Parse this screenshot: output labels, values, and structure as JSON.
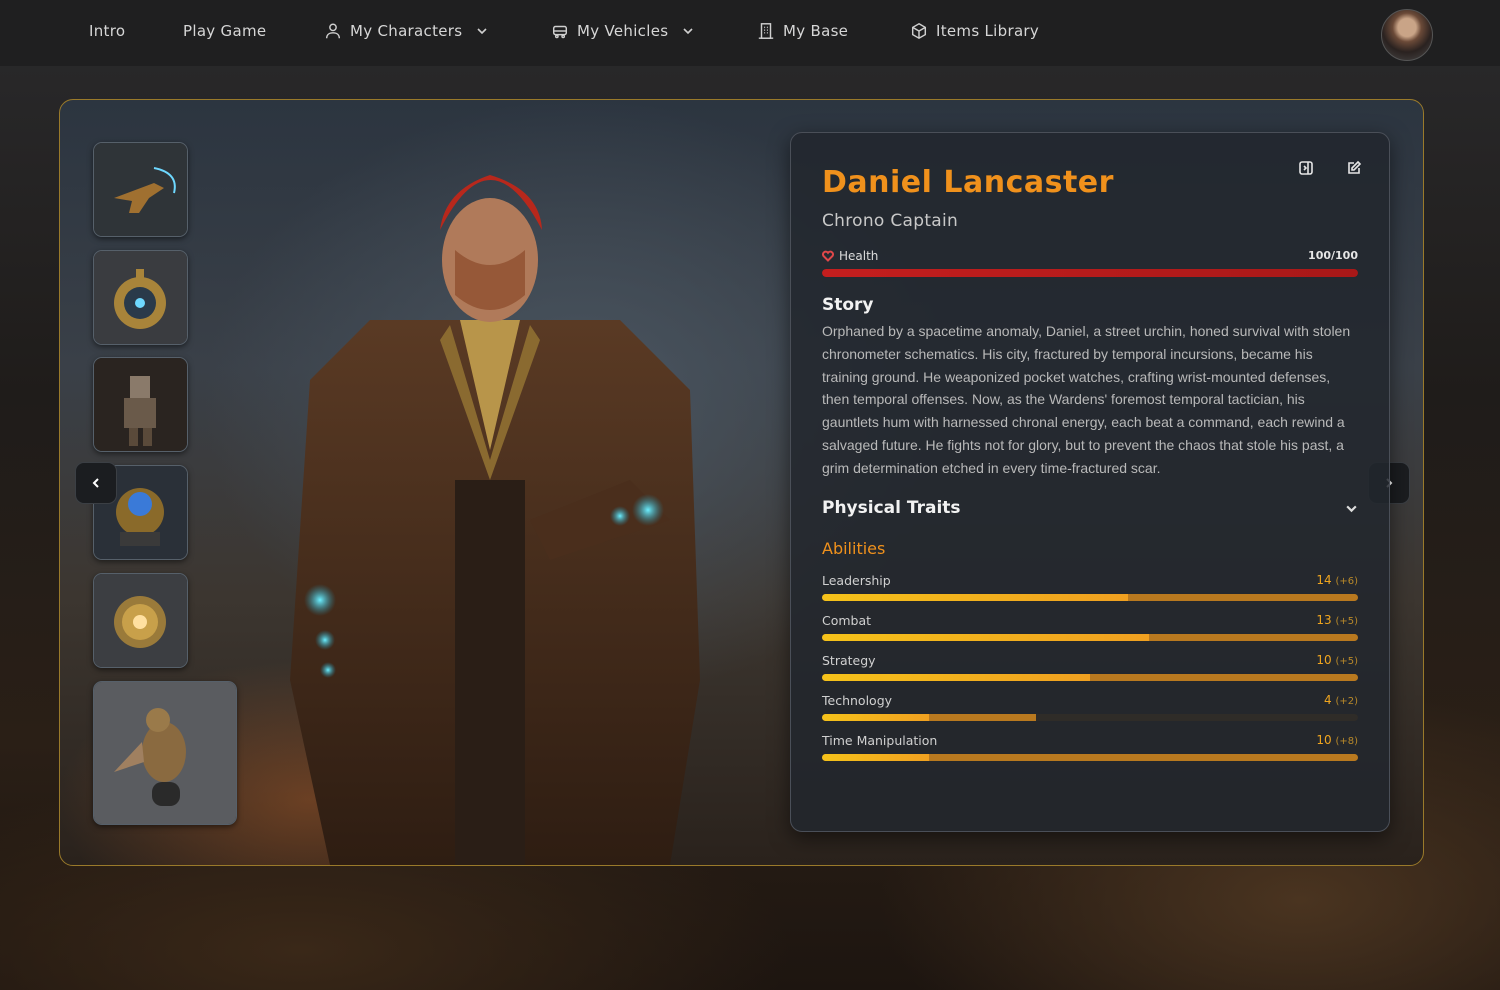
{
  "nav": {
    "items": [
      {
        "label": "Intro",
        "icon": null,
        "dropdown": false
      },
      {
        "label": "Play Game",
        "icon": null,
        "dropdown": false
      },
      {
        "label": "My Characters",
        "icon": "user-group-icon",
        "dropdown": true
      },
      {
        "label": "My Vehicles",
        "icon": "car-icon",
        "dropdown": true
      },
      {
        "label": "My Base",
        "icon": "building-icon",
        "dropdown": false
      },
      {
        "label": "Items Library",
        "icon": "cube-icon",
        "dropdown": false
      }
    ]
  },
  "character": {
    "name": "Daniel Lancaster",
    "title": "Chrono Captain",
    "health": {
      "label": "Health",
      "value": "100/100",
      "fraction": 1.0
    },
    "story_heading": "Story",
    "story": "Orphaned by a spacetime anomaly, Daniel, a street urchin, honed survival with stolen chronometer schematics. His city, fractured by temporal incursions, became his training ground. He weaponized pocket watches, crafting wrist-mounted defenses, then temporal offenses. Now, as the Wardens' foremost temporal tactician, his gauntlets hum with harnessed chronal energy, each beat a command, each rewind a salvaged future. He fights not for glory, but to prevent the chaos that stole his past, a grim determination etched in every time-fractured scar.",
    "traits_heading": "Physical Traits",
    "abilities_heading": "Abilities",
    "abilities": [
      {
        "name": "Leadership",
        "value": "14",
        "bonus": "(+6)",
        "base_fraction": 0.57,
        "total_fraction": 1.0
      },
      {
        "name": "Combat",
        "value": "13",
        "bonus": "(+5)",
        "base_fraction": 0.61,
        "total_fraction": 1.0
      },
      {
        "name": "Strategy",
        "value": "10",
        "bonus": "(+5)",
        "base_fraction": 0.5,
        "total_fraction": 1.0
      },
      {
        "name": "Technology",
        "value": "4",
        "bonus": "(+2)",
        "base_fraction": 0.2,
        "total_fraction": 0.4
      },
      {
        "name": "Time Manipulation",
        "value": "10",
        "bonus": "(+8)",
        "base_fraction": 0.2,
        "total_fraction": 1.0
      }
    ]
  },
  "colors": {
    "accent": "#f0911c",
    "health": "#c41e1e",
    "frame_border": "#9a7a2a"
  }
}
